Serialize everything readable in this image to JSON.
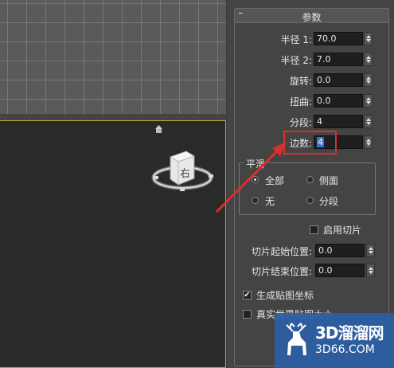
{
  "rollout": {
    "collapse_symbol": "–",
    "title": "参数"
  },
  "params": [
    {
      "label": "半径 1:",
      "value": "70.0"
    },
    {
      "label": "半径 2:",
      "value": "7.0"
    },
    {
      "label": "旋转:",
      "value": "0.0"
    },
    {
      "label": "扭曲:",
      "value": "0.0"
    },
    {
      "label": "分段:",
      "value": "4"
    },
    {
      "label": "边数:",
      "value": "4"
    }
  ],
  "smooth": {
    "title": "平滑",
    "options": [
      {
        "label": "全部",
        "selected": true
      },
      {
        "label": "侧面",
        "selected": false
      },
      {
        "label": "无",
        "selected": false
      },
      {
        "label": "分段",
        "selected": false
      }
    ]
  },
  "slice": {
    "enable_label": "启用切片",
    "enable_checked": false,
    "from_label": "切片起始位置:",
    "from_value": "0.0",
    "to_label": "切片结束位置:",
    "to_value": "0.0"
  },
  "mapping": {
    "gen_uv_label": "生成贴图坐标",
    "gen_uv_checked": true,
    "real_world_label": "真实世界贴图大小",
    "real_world_checked": false
  },
  "viewcube": {
    "face_label": "右"
  },
  "watermark": {
    "brand": "3D溜溜网",
    "domain": "3D66.COM"
  },
  "colors": {
    "highlight": "#d8302a",
    "selection": "#3a6fd8",
    "viewport_border": "#c2a43a"
  }
}
